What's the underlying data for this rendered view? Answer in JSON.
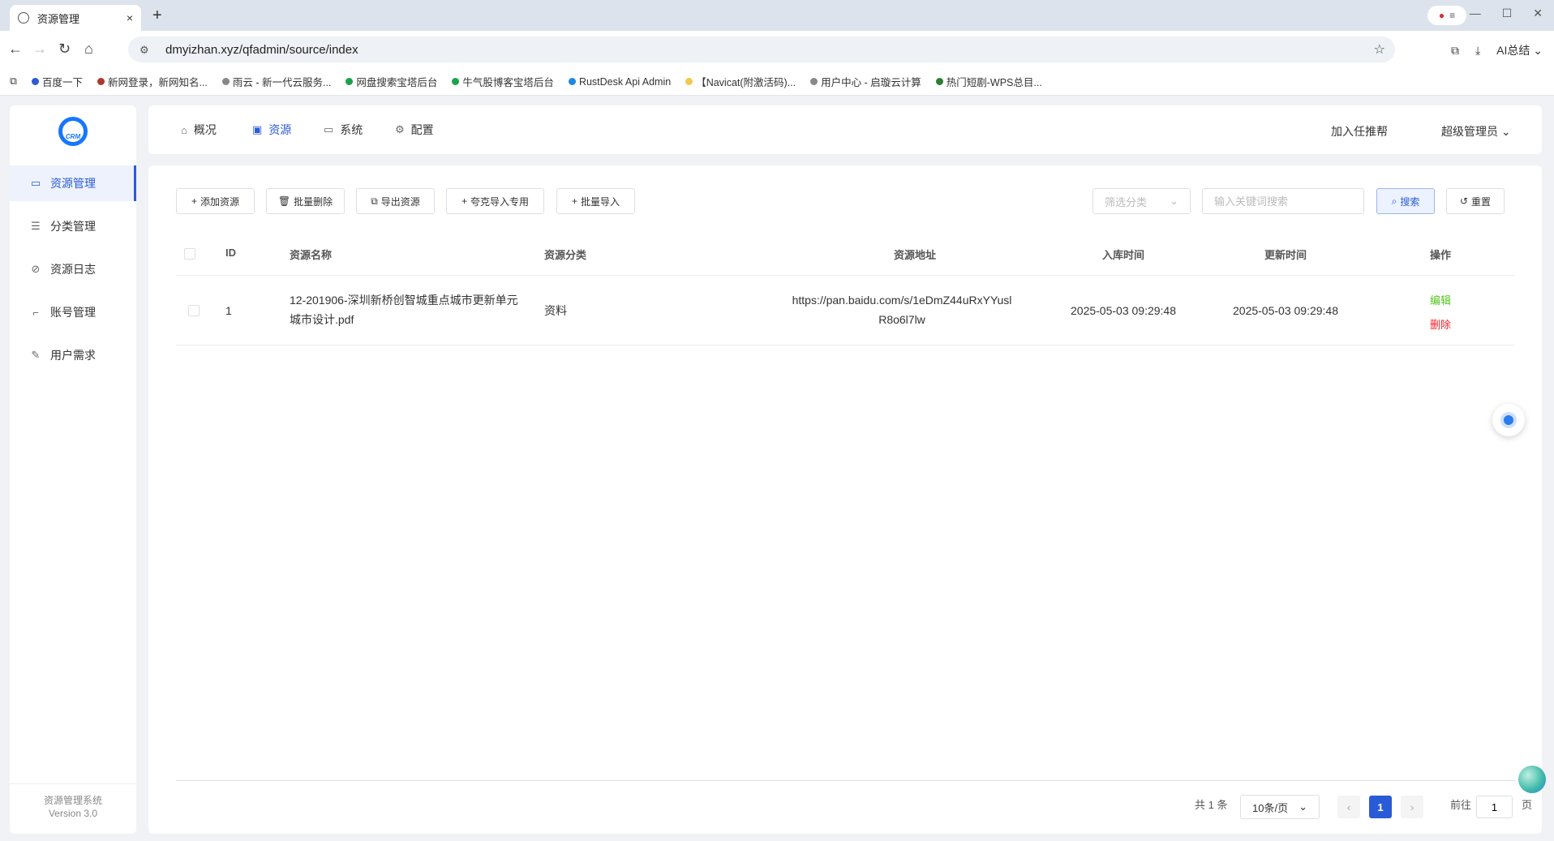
{
  "browser": {
    "tab_title": "资源管理",
    "tab_close": "×",
    "new_tab": "+",
    "url": "dmyizhan.xyz/qfadmin/source/index",
    "ai_summary": "AI总结",
    "bookmarks": [
      {
        "label": "百度一下",
        "color": "#2f5bd3"
      },
      {
        "label": "新网登录，新网知名...",
        "color": "#b0382c"
      },
      {
        "label": "雨云 - 新一代云服务...",
        "color": "#888888"
      },
      {
        "label": "网盘搜索宝塔后台",
        "color": "#1aa34a"
      },
      {
        "label": "牛气股博客宝塔后台",
        "color": "#1aa34a"
      },
      {
        "label": "RustDesk Api Admin",
        "color": "#1e88e5"
      },
      {
        "label": "【Navicat(附激活码)...",
        "color": "#f2c94c"
      },
      {
        "label": "用户中心 - 启璇云计算",
        "color": "#888888"
      },
      {
        "label": "热门短剧-WPS总目...",
        "color": "#2e7d32"
      }
    ]
  },
  "sidebar": {
    "logo_text": "CRM",
    "items": [
      {
        "label": "资源管理",
        "icon": "folder-icon"
      },
      {
        "label": "分类管理",
        "icon": "sliders-icon"
      },
      {
        "label": "资源日志",
        "icon": "compass-icon"
      },
      {
        "label": "账号管理",
        "icon": "crop-icon"
      },
      {
        "label": "用户需求",
        "icon": "pen-icon"
      }
    ],
    "footer_title": "资源管理系统",
    "footer_version": "Version 3.0"
  },
  "topnav": {
    "items": [
      {
        "label": "概况",
        "icon": "home-icon"
      },
      {
        "label": "资源",
        "icon": "box-icon"
      },
      {
        "label": "系统",
        "icon": "monitor-icon"
      },
      {
        "label": "配置",
        "icon": "gear-icon"
      }
    ],
    "recommend": "加入任推帮",
    "user": "超级管理员"
  },
  "toolbar": {
    "add": "添加资源",
    "batch_delete": "批量删除",
    "export": "导出资源",
    "quark_import": "夸克导入专用",
    "batch_import": "批量导入",
    "filter_placeholder": "筛选分类",
    "search_placeholder": "输入关键词搜索",
    "search": "搜索",
    "reset": "重置"
  },
  "table": {
    "headers": {
      "id": "ID",
      "name": "资源名称",
      "category": "资源分类",
      "url": "资源地址",
      "created": "入库时间",
      "updated": "更新时间",
      "actions": "操作"
    },
    "rows": [
      {
        "id": "1",
        "name_line1": "12-201906-深圳新桥创智城重点城市更新单元",
        "name_line2": "城市设计.pdf",
        "category": "资料",
        "url_line1": "https://pan.baidu.com/s/1eDmZ44uRxYYusl",
        "url_line2": "R8o6l7lw",
        "created": "2025-05-03 09:29:48",
        "updated": "2025-05-03 09:29:48",
        "edit": "编辑",
        "delete": "删除"
      }
    ]
  },
  "pagination": {
    "total": "共 1 条",
    "page_size": "10条/页",
    "current_page": "1",
    "goto_label": "前往",
    "goto_value": "1",
    "page_suffix": "页"
  }
}
